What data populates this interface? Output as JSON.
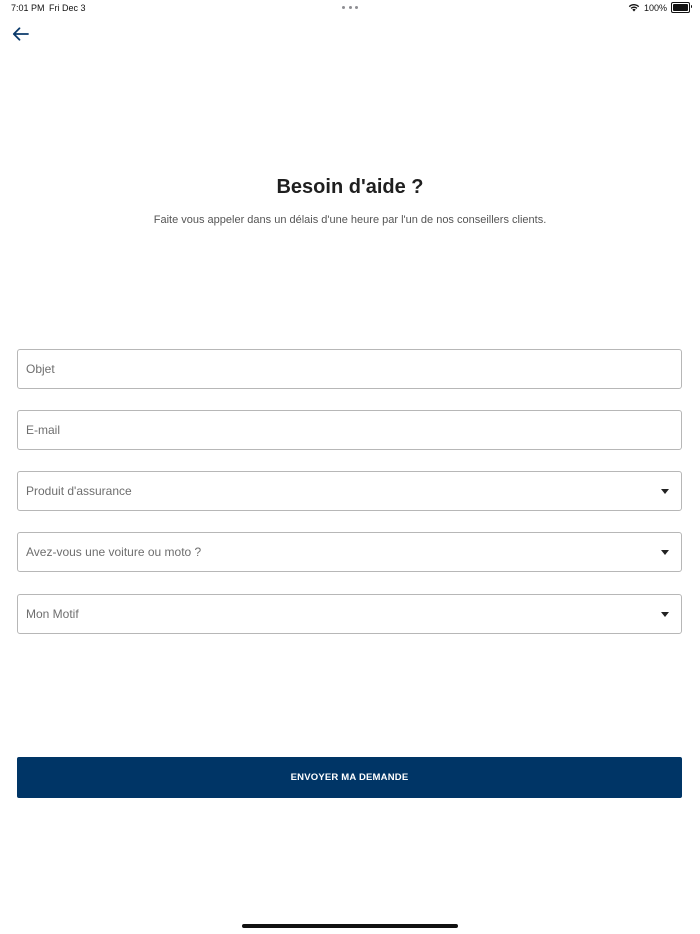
{
  "status_bar": {
    "time": "7:01 PM",
    "date": "Fri Dec 3",
    "battery": "100%"
  },
  "header": {
    "back_icon": "arrow-left-icon"
  },
  "main": {
    "title": "Besoin d'aide ?",
    "subtitle": "Faite vous appeler dans un délais d'une heure par l'un de nos conseillers clients."
  },
  "form": {
    "subject": {
      "placeholder": "Objet",
      "value": ""
    },
    "email": {
      "placeholder": "E-mail",
      "value": ""
    },
    "insurance_product": {
      "placeholder": "Produit d'assurance"
    },
    "vehicle_type": {
      "placeholder": "Avez-vous une voiture ou moto ?"
    },
    "reason": {
      "placeholder": "Mon Motif"
    },
    "submit_label": "ENVOYER MA DEMANDE"
  },
  "colors": {
    "accent": "#003566",
    "back_icon": "#0b3a6b",
    "border": "#b7b7b7"
  }
}
